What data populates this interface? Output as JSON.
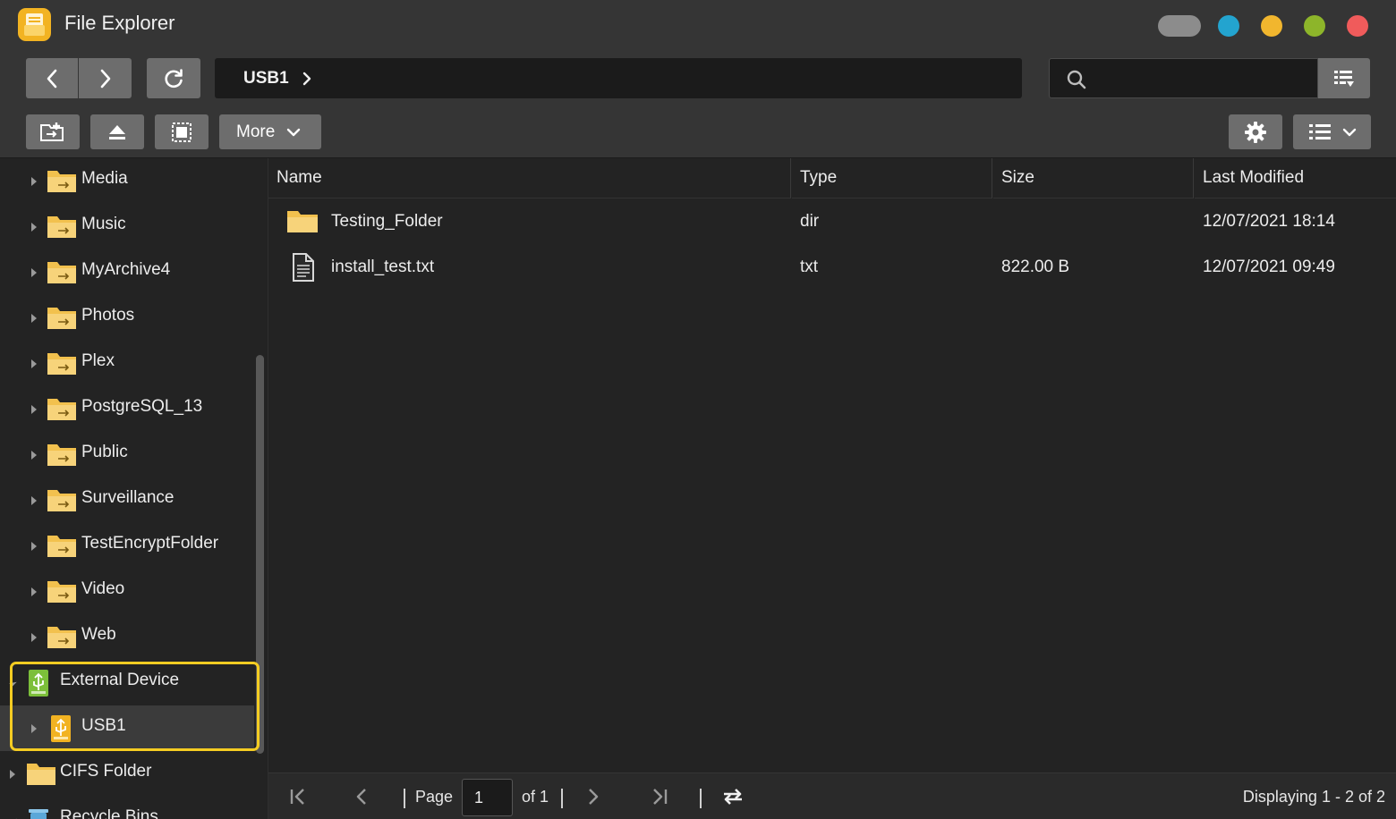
{
  "window": {
    "title": "File Explorer"
  },
  "toolbar": {
    "more_label": "More"
  },
  "breadcrumb": {
    "current": "USB1"
  },
  "search": {
    "placeholder": "",
    "value": ""
  },
  "colors": {
    "accent": "#f2b322",
    "highlight": "#f4cc22",
    "folder": "#f2c14e"
  },
  "sidebar": {
    "shares": [
      "Media",
      "Music",
      "MyArchive4",
      "Photos",
      "Plex",
      "PostgreSQL_13",
      "Public",
      "Surveillance",
      "TestEncryptFolder",
      "Video",
      "Web"
    ],
    "external_device": "External Device",
    "usb": "USB1",
    "cifs": "CIFS Folder",
    "recycle": "Recycle Bins"
  },
  "table": {
    "columns": {
      "name": "Name",
      "type": "Type",
      "size": "Size",
      "modified": "Last Modified"
    },
    "rows": [
      {
        "icon": "folder-icon",
        "name": "Testing_Folder",
        "type": "dir",
        "size": "",
        "modified": "12/07/2021 18:14"
      },
      {
        "icon": "file-icon",
        "name": "install_test.txt",
        "type": "txt",
        "size": "822.00 B",
        "modified": "12/07/2021 09:49"
      }
    ]
  },
  "pagination": {
    "page_label": "Page",
    "page_value": "1",
    "of_label": "of 1",
    "display": "Displaying 1 - 2 of 2"
  }
}
